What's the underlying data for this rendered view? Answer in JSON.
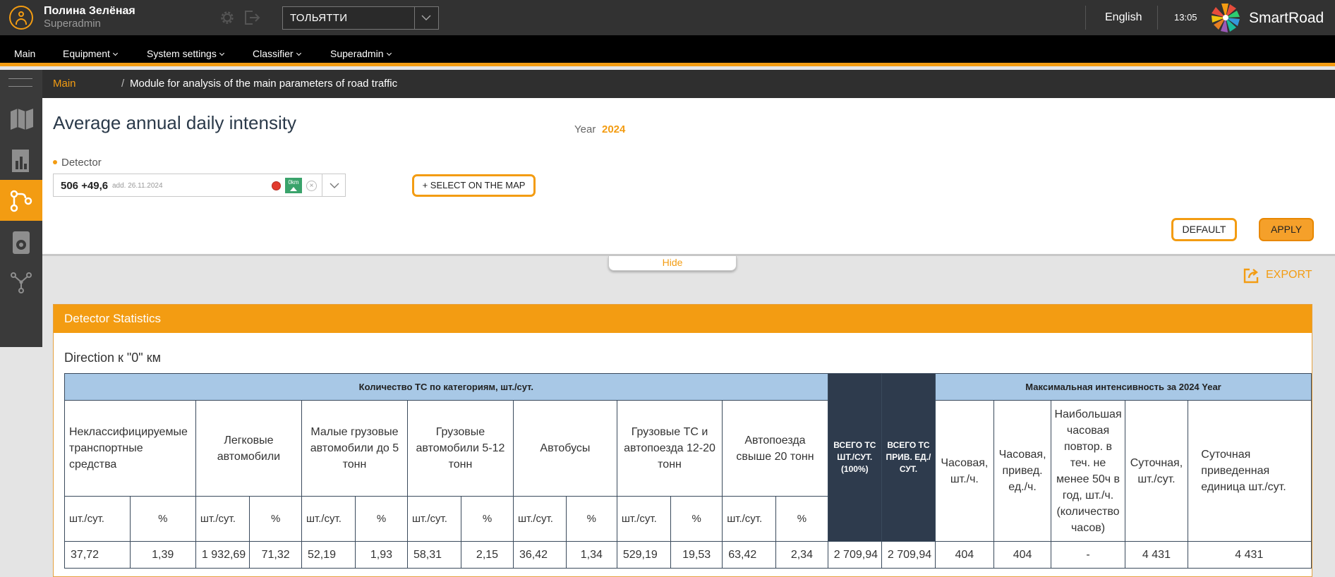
{
  "user": {
    "name": "Полина Зелёная",
    "role": "Superadmin"
  },
  "city_select": {
    "value": "ТОЛЬЯТТИ"
  },
  "language": "English",
  "clock": "13:05",
  "brand": {
    "name": "SmartRoad",
    "accent": "#f39c12"
  },
  "nav": [
    {
      "label": "Main",
      "dropdown": false
    },
    {
      "label": "Equipment",
      "dropdown": true
    },
    {
      "label": "System settings",
      "dropdown": true
    },
    {
      "label": "Classifier",
      "dropdown": true
    },
    {
      "label": "Superadmin",
      "dropdown": true
    }
  ],
  "sidebar": {
    "items": [
      {
        "icon": "map-icon"
      },
      {
        "icon": "report-icon"
      },
      {
        "icon": "route-icon",
        "active": true
      },
      {
        "icon": "camera-device-icon"
      },
      {
        "icon": "network-icon"
      }
    ]
  },
  "breadcrumb": {
    "main": "Main",
    "separator": "/",
    "current": "Module for analysis of the main parameters of road traffic"
  },
  "filters": {
    "title": "Average annual daily intensity",
    "year_label": "Year",
    "year_value": "2024",
    "detector_label": "Detector",
    "detector_value": "506 +49,6",
    "detector_added": "add. 26.11.2024",
    "detector_km": "0km",
    "detector_clear": "×",
    "select_on_map": "+ SELECT ON THE MAP",
    "default": "DEFAULT",
    "apply": "APPLY",
    "hide": "Hide"
  },
  "export_label": "EXPORT",
  "stats": {
    "title": "Detector Statistics",
    "direction": "Direction к \"0\" км",
    "group_header_categories": "Количество ТС по категориям, шт./сут.",
    "total_count_header": "ВСЕГО ТС ШТ./СУТ. (100%)",
    "total_reduced_header": "ВСЕГО ТС ПРИВ. ЕД./СУТ.",
    "group_header_max": "Максимальная интенсивность за 2024 Year",
    "categories": [
      "Неклассифицируемые транспортные средства",
      "Легковые автомобили",
      "Малые грузовые автомобили до 5 тонн",
      "Грузовые автомобили 5-12 тонн",
      "Автобусы",
      "Грузовые ТС и автопоезда 12-20 тонн",
      "Автопоезда свыше 20 тонн"
    ],
    "unit_count": "шт./сут.",
    "unit_percent": "%",
    "max_columns": [
      "Часовая, шт./ч.",
      "Часовая, привед. ед./ч.",
      "Наибольшая часовая повтор. в теч. не менее 50ч в год, шт./ч. (количество часов)",
      "Суточная, шт./сут.",
      "Суточная приведенная единица шт./сут."
    ],
    "row": {
      "categories": [
        [
          "37,72",
          "1,39"
        ],
        [
          "1 932,69",
          "71,32"
        ],
        [
          "52,19",
          "1,93"
        ],
        [
          "58,31",
          "2,15"
        ],
        [
          "36,42",
          "1,34"
        ],
        [
          "529,19",
          "19,53"
        ],
        [
          "63,42",
          "2,34"
        ]
      ],
      "total_count": "2 709,94",
      "total_reduced": "2 709,94",
      "max_values": [
        "404",
        "404",
        "-",
        "4 431",
        "4 431"
      ]
    }
  }
}
